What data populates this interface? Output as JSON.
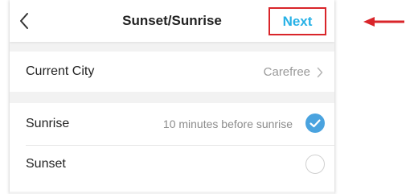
{
  "header": {
    "title": "Sunset/Sunrise",
    "next_label": "Next",
    "back_icon": "chevron-left-icon"
  },
  "city": {
    "label": "Current City",
    "value": "Carefree",
    "chevron_icon": "chevron-right-icon"
  },
  "options": [
    {
      "label": "Sunrise",
      "detail": "10 minutes before sunrise",
      "selected": true
    },
    {
      "label": "Sunset",
      "detail": "",
      "selected": false
    }
  ],
  "colors": {
    "accent": "#27b1e6",
    "annotation": "#d9252a",
    "background": "#f2f2f2"
  }
}
